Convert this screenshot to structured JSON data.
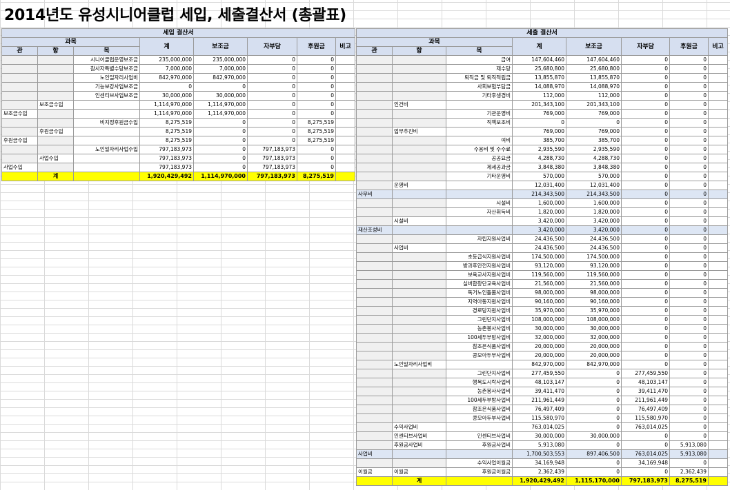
{
  "title": "2014년도 유성시니어클럽 세입, 세출결산서 (총괄표)",
  "columns": {
    "subject": "과목",
    "kwan": "관",
    "hang": "항",
    "mok": "목",
    "total": "계",
    "subsidy": "보조금",
    "self": "자부담",
    "donation": "후원금",
    "remark": "비고"
  },
  "revenue": {
    "caption": "세입 결산서",
    "rows": [
      {
        "k": "",
        "h": "",
        "m": "시니어클럽운영보조금",
        "t": "235,000,000",
        "s": "235,000,000",
        "self": "0",
        "d": "0"
      },
      {
        "k": "",
        "h": "",
        "m": "참사자특별수당보조금",
        "t": "7,000,000",
        "s": "7,000,000",
        "self": "0",
        "d": "0"
      },
      {
        "k": "",
        "h": "",
        "m": "노인일자리사업비",
        "t": "842,970,000",
        "s": "842,970,000",
        "self": "0",
        "d": "0"
      },
      {
        "k": "",
        "h": "",
        "m": "기능보강사업보조금",
        "t": "0",
        "s": "0",
        "self": "0",
        "d": "0"
      },
      {
        "k": "",
        "h": "",
        "m": "인센티브사업보조금",
        "t": "30,000,000",
        "s": "30,000,000",
        "self": "0",
        "d": "0"
      },
      {
        "k": "",
        "h": "보조금수입",
        "m": "",
        "t": "1,114,970,000",
        "s": "1,114,970,000",
        "self": "0",
        "d": "0"
      },
      {
        "k": "보조금수입",
        "h": "",
        "m": "",
        "t": "1,114,970,000",
        "s": "1,114,970,000",
        "self": "0",
        "d": "0"
      },
      {
        "k": "",
        "h": "",
        "m": "비지정후원금수입",
        "t": "8,275,519",
        "s": "0",
        "self": "0",
        "d": "8,275,519"
      },
      {
        "k": "",
        "h": "후원금수입",
        "m": "",
        "t": "8,275,519",
        "s": "0",
        "self": "0",
        "d": "8,275,519"
      },
      {
        "k": "후원금수입",
        "h": "",
        "m": "",
        "t": "8,275,519",
        "s": "0",
        "self": "0",
        "d": "8,275,519"
      },
      {
        "k": "",
        "h": "",
        "m": "노인일자리사업수입",
        "t": "797,183,973",
        "s": "0",
        "self": "797,183,973",
        "d": "0"
      },
      {
        "k": "",
        "h": "사업수입",
        "m": "",
        "t": "797,183,973",
        "s": "0",
        "self": "797,183,973",
        "d": "0"
      },
      {
        "k": "사업수입",
        "h": "",
        "m": "",
        "t": "797,183,973",
        "s": "0",
        "self": "797,183,973",
        "d": "0"
      }
    ],
    "total": {
      "label": "계",
      "t": "1,920,429,492",
      "s": "1,114,970,000",
      "self": "797,183,973",
      "d": "8,275,519"
    }
  },
  "expense": {
    "caption": "세출 결산서",
    "rows": [
      {
        "k": "",
        "h": "",
        "m": "급여",
        "t": "147,604,460",
        "s": "147,604,460",
        "self": "0",
        "d": "0"
      },
      {
        "k": "",
        "h": "",
        "m": "제수당",
        "t": "25,680,800",
        "s": "25,680,800",
        "self": "0",
        "d": "0"
      },
      {
        "k": "",
        "h": "",
        "m": "퇴직금 및 퇴직적립금",
        "t": "13,855,870",
        "s": "13,855,870",
        "self": "0",
        "d": "0"
      },
      {
        "k": "",
        "h": "",
        "m": "사회보험부담금",
        "t": "14,088,970",
        "s": "14,088,970",
        "self": "0",
        "d": "0"
      },
      {
        "k": "",
        "h": "",
        "m": "기타후생경비",
        "t": "112,000",
        "s": "112,000",
        "self": "0",
        "d": "0"
      },
      {
        "k": "",
        "h": "인건비",
        "m": "",
        "t": "201,343,100",
        "s": "201,343,100",
        "self": "0",
        "d": "0"
      },
      {
        "k": "",
        "h": "",
        "m": "기관운영비",
        "t": "769,000",
        "s": "769,000",
        "self": "0",
        "d": "0"
      },
      {
        "k": "",
        "h": "",
        "m": "직책보조비",
        "t": "0",
        "s": "0",
        "self": "0",
        "d": "0"
      },
      {
        "k": "",
        "h": "업무추진비",
        "m": "",
        "t": "769,000",
        "s": "769,000",
        "self": "0",
        "d": "0"
      },
      {
        "k": "",
        "h": "",
        "m": "여비",
        "t": "385,700",
        "s": "385,700",
        "self": "0",
        "d": "0"
      },
      {
        "k": "",
        "h": "",
        "m": "수용비 및 수수료",
        "t": "2,935,590",
        "s": "2,935,590",
        "self": "0",
        "d": "0"
      },
      {
        "k": "",
        "h": "",
        "m": "공공요금",
        "t": "4,288,730",
        "s": "4,288,730",
        "self": "0",
        "d": "0"
      },
      {
        "k": "",
        "h": "",
        "m": "제세공과금",
        "t": "3,848,380",
        "s": "3,848,380",
        "self": "0",
        "d": "0"
      },
      {
        "k": "",
        "h": "",
        "m": "기타운영비",
        "t": "570,000",
        "s": "570,000",
        "self": "0",
        "d": "0"
      },
      {
        "k": "",
        "h": "운영비",
        "m": "",
        "t": "12,031,400",
        "s": "12,031,400",
        "self": "0",
        "d": "0"
      },
      {
        "k": "사무비",
        "h": "",
        "m": "",
        "t": "214,343,500",
        "s": "214,343,500",
        "self": "0",
        "d": "0",
        "sec": true
      },
      {
        "k": "",
        "h": "",
        "m": "시설비",
        "t": "1,600,000",
        "s": "1,600,000",
        "self": "0",
        "d": "0"
      },
      {
        "k": "",
        "h": "",
        "m": "자산취득비",
        "t": "1,820,000",
        "s": "1,820,000",
        "self": "0",
        "d": "0"
      },
      {
        "k": "",
        "h": "시설비",
        "m": "",
        "t": "3,420,000",
        "s": "3,420,000",
        "self": "0",
        "d": "0"
      },
      {
        "k": "재산조성비",
        "h": "",
        "m": "",
        "t": "3,420,000",
        "s": "3,420,000",
        "self": "0",
        "d": "0",
        "sec": true
      },
      {
        "k": "",
        "h": "",
        "m": "자립지원사업비",
        "t": "24,436,500",
        "s": "24,436,500",
        "self": "0",
        "d": "0"
      },
      {
        "k": "",
        "h": "사업비",
        "m": "",
        "t": "24,436,500",
        "s": "24,436,500",
        "self": "0",
        "d": "0"
      },
      {
        "k": "",
        "h": "",
        "m": "초등급식지원사업비",
        "t": "174,500,000",
        "s": "174,500,000",
        "self": "0",
        "d": "0"
      },
      {
        "k": "",
        "h": "",
        "m": "방과후안전지원사업비",
        "t": "93,120,000",
        "s": "93,120,000",
        "self": "0",
        "d": "0"
      },
      {
        "k": "",
        "h": "",
        "m": "보육교사지원사업비",
        "t": "119,560,000",
        "s": "119,560,000",
        "self": "0",
        "d": "0"
      },
      {
        "k": "",
        "h": "",
        "m": "실버합창단교육사업비",
        "t": "21,560,000",
        "s": "21,560,000",
        "self": "0",
        "d": "0"
      },
      {
        "k": "",
        "h": "",
        "m": "독거노인돌봄사업비",
        "t": "98,000,000",
        "s": "98,000,000",
        "self": "0",
        "d": "0"
      },
      {
        "k": "",
        "h": "",
        "m": "지역아동지원사업비",
        "t": "90,160,000",
        "s": "90,160,000",
        "self": "0",
        "d": "0"
      },
      {
        "k": "",
        "h": "",
        "m": "경로당지원사업비",
        "t": "35,970,000",
        "s": "35,970,000",
        "self": "0",
        "d": "0"
      },
      {
        "k": "",
        "h": "",
        "m": "그린단지사업비",
        "t": "108,000,000",
        "s": "108,000,000",
        "self": "0",
        "d": "0"
      },
      {
        "k": "",
        "h": "",
        "m": "농촌봉사사업비",
        "t": "30,000,000",
        "s": "30,000,000",
        "self": "0",
        "d": "0"
      },
      {
        "k": "",
        "h": "",
        "m": "100세두부방사업비",
        "t": "32,000,000",
        "s": "32,000,000",
        "self": "0",
        "d": "0"
      },
      {
        "k": "",
        "h": "",
        "m": "참조은식품사업비",
        "t": "20,000,000",
        "s": "20,000,000",
        "self": "0",
        "d": "0"
      },
      {
        "k": "",
        "h": "",
        "m": "콩모아두부사업비",
        "t": "20,000,000",
        "s": "20,000,000",
        "self": "0",
        "d": "0"
      },
      {
        "k": "",
        "h": "노인일자리사업비",
        "m": "",
        "t": "842,970,000",
        "s": "842,970,000",
        "self": "0",
        "d": "0"
      },
      {
        "k": "",
        "h": "",
        "m": "그린단지사업비",
        "t": "277,459,550",
        "s": "0",
        "self": "277,459,550",
        "d": "0"
      },
      {
        "k": "",
        "h": "",
        "m": "행복도시락사업비",
        "t": "48,103,147",
        "s": "0",
        "self": "48,103,147",
        "d": "0"
      },
      {
        "k": "",
        "h": "",
        "m": "농촌봉사사업비",
        "t": "39,411,470",
        "s": "0",
        "self": "39,411,470",
        "d": "0"
      },
      {
        "k": "",
        "h": "",
        "m": "100세두부방사업비",
        "t": "211,961,449",
        "s": "0",
        "self": "211,961,449",
        "d": "0"
      },
      {
        "k": "",
        "h": "",
        "m": "참조은식품사업비",
        "t": "76,497,409",
        "s": "0",
        "self": "76,497,409",
        "d": "0"
      },
      {
        "k": "",
        "h": "",
        "m": "콩모아두부사업비",
        "t": "115,580,970",
        "s": "0",
        "self": "115,580,970",
        "d": "0"
      },
      {
        "k": "",
        "h": "수익사업비",
        "m": "",
        "t": "763,014,025",
        "s": "0",
        "self": "763,014,025",
        "d": "0"
      },
      {
        "k": "",
        "h": "인센티브사업비",
        "m": "인센티브사업비",
        "t": "30,000,000",
        "s": "30,000,000",
        "self": "0",
        "d": "0"
      },
      {
        "k": "",
        "h": "후원금사업비",
        "m": "후원금사업비",
        "t": "5,913,080",
        "s": "0",
        "self": "0",
        "d": "5,913,080"
      },
      {
        "k": "사업비",
        "h": "",
        "m": "",
        "t": "1,700,503,553",
        "s": "897,406,500",
        "self": "763,014,025",
        "d": "5,913,080",
        "sec": true
      },
      {
        "k": "",
        "h": "",
        "m": "수익사업이월금",
        "t": "34,169,948",
        "s": "0",
        "self": "34,169,948",
        "d": "0"
      },
      {
        "k": "이월금",
        "h": "이월금",
        "m": "후원금이월금",
        "t": "2,362,439",
        "s": "0",
        "self": "0",
        "d": "2,362,439"
      }
    ],
    "total": {
      "label": "계",
      "t": "1,920,429,492",
      "s": "1,115,170,000",
      "self": "797,183,973",
      "d": "8,275,519"
    }
  }
}
